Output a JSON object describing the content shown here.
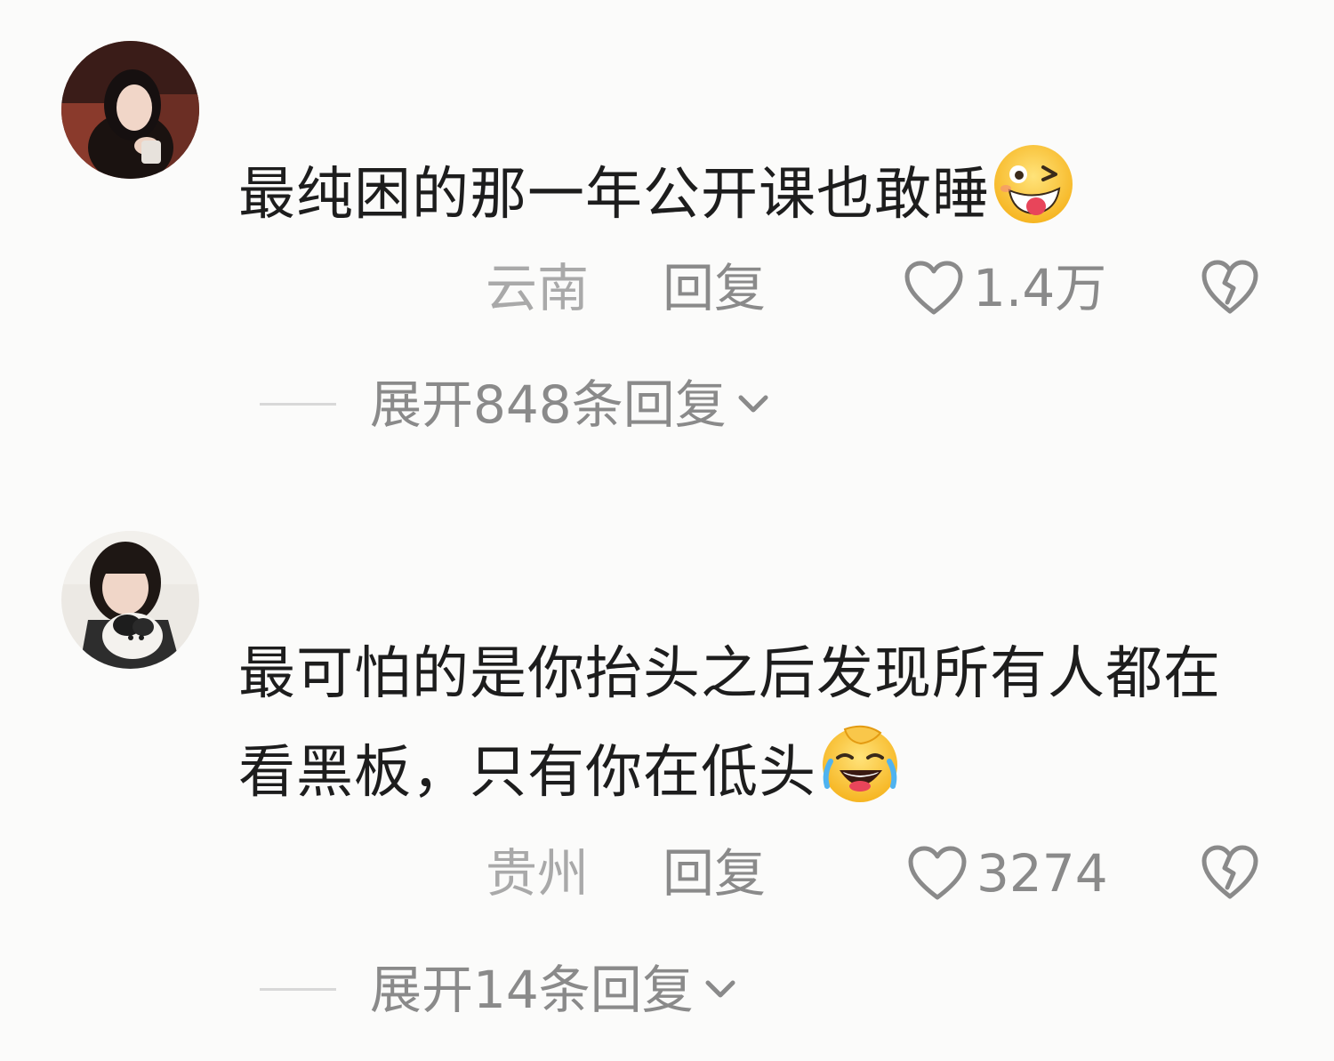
{
  "comments": [
    {
      "text": "最纯困的那一年公开课也敢睡",
      "emoji_icon": "winking-face-with-tongue-icon",
      "location": "云南",
      "reply_label": "回复",
      "like_count": "1.4万",
      "expand_label": "展开848条回复"
    },
    {
      "text": "最可怕的是你抬头之后发现所有人都在看黑板，只有你在低头",
      "emoji_icon": "rolling-on-floor-laughing-icon",
      "location": "贵州",
      "reply_label": "回复",
      "like_count": "3274",
      "expand_label": "展开14条回复"
    }
  ],
  "colors": {
    "text": "#1d1d1d",
    "meta": "#8a8a8a",
    "location": "#a9a9a9",
    "background": "#fbfbfa"
  }
}
